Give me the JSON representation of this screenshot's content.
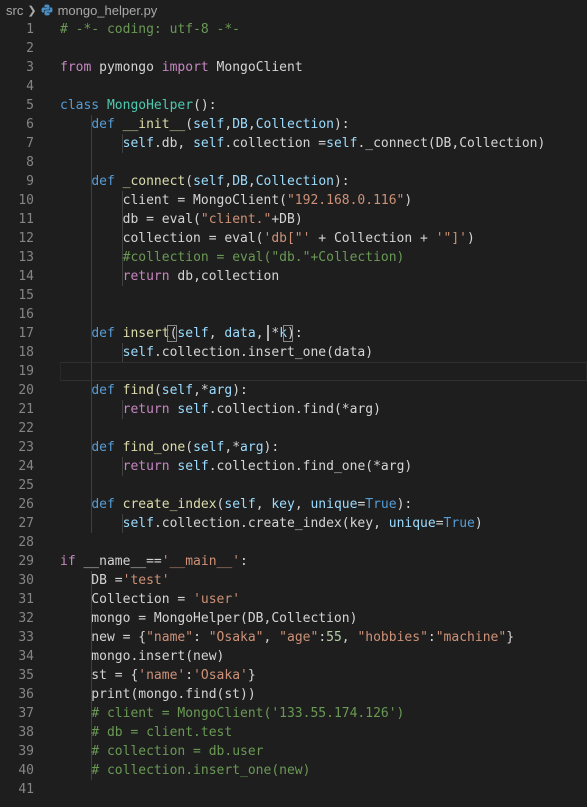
{
  "breadcrumb": {
    "folder": "src",
    "file": "mongo_helper.py",
    "file_icon": "python-icon"
  },
  "colors": {
    "background": "#1e1e1e",
    "keyword": "#569cd6",
    "control": "#c586c0",
    "function": "#dcdcaa",
    "class": "#4ec9b0",
    "string": "#ce9178",
    "number": "#b5cea8",
    "comment": "#6a9955",
    "variable": "#9cdcfe",
    "plain": "#d4d4d4",
    "line_number": "#858585"
  },
  "editor": {
    "active_line": 19,
    "lines": [
      {
        "n": "1",
        "t": [
          [
            "com",
            "# -*- coding: utf-8 -*-"
          ]
        ]
      },
      {
        "n": "2",
        "t": []
      },
      {
        "n": "3",
        "t": [
          [
            "ctl",
            "from"
          ],
          [
            "pl",
            " pymongo "
          ],
          [
            "ctl",
            "import"
          ],
          [
            "pl",
            " MongoClient"
          ]
        ]
      },
      {
        "n": "4",
        "t": []
      },
      {
        "n": "5",
        "t": [
          [
            "kw",
            "class"
          ],
          [
            "pl",
            " "
          ],
          [
            "cls",
            "MongoHelper"
          ],
          [
            "pl",
            "():"
          ]
        ]
      },
      {
        "n": "6",
        "t": [
          [
            "pl",
            "    "
          ],
          [
            "kw",
            "def"
          ],
          [
            "pl",
            " "
          ],
          [
            "fn",
            "__init__"
          ],
          [
            "pl",
            "("
          ],
          [
            "var",
            "self"
          ],
          [
            "pl",
            ","
          ],
          [
            "var",
            "DB"
          ],
          [
            "pl",
            ","
          ],
          [
            "var",
            "Collection"
          ],
          [
            "pl",
            "):"
          ]
        ]
      },
      {
        "n": "7",
        "t": [
          [
            "pl",
            "        "
          ],
          [
            "var",
            "self"
          ],
          [
            "pl",
            ".db, "
          ],
          [
            "var",
            "self"
          ],
          [
            "pl",
            ".collection ="
          ],
          [
            "var",
            "self"
          ],
          [
            "pl",
            "._connect(DB,Collection)"
          ]
        ]
      },
      {
        "n": "8",
        "t": []
      },
      {
        "n": "9",
        "t": [
          [
            "pl",
            "    "
          ],
          [
            "kw",
            "def"
          ],
          [
            "pl",
            " "
          ],
          [
            "fn",
            "_connect"
          ],
          [
            "pl",
            "("
          ],
          [
            "var",
            "self"
          ],
          [
            "pl",
            ","
          ],
          [
            "var",
            "DB"
          ],
          [
            "pl",
            ","
          ],
          [
            "var",
            "Collection"
          ],
          [
            "pl",
            "):"
          ]
        ]
      },
      {
        "n": "10",
        "t": [
          [
            "pl",
            "        client = MongoClient("
          ],
          [
            "str",
            "\"192.168.0.116\""
          ],
          [
            "pl",
            ")"
          ]
        ]
      },
      {
        "n": "11",
        "t": [
          [
            "pl",
            "        db = eval("
          ],
          [
            "str",
            "\"client.\""
          ],
          [
            "pl",
            "+DB)"
          ]
        ]
      },
      {
        "n": "12",
        "t": [
          [
            "pl",
            "        collection = eval("
          ],
          [
            "str",
            "'db[\"'"
          ],
          [
            "pl",
            " + Collection + "
          ],
          [
            "str",
            "'\"]'"
          ],
          [
            "pl",
            ")"
          ]
        ]
      },
      {
        "n": "13",
        "t": [
          [
            "pl",
            "        "
          ],
          [
            "com",
            "#collection = eval(\"db.\"+Collection)"
          ]
        ]
      },
      {
        "n": "14",
        "t": [
          [
            "pl",
            "        "
          ],
          [
            "ctl",
            "return"
          ],
          [
            "pl",
            " db,collection"
          ]
        ]
      },
      {
        "n": "15",
        "t": []
      },
      {
        "n": "16",
        "t": []
      },
      {
        "n": "17",
        "t": [
          [
            "pl",
            "    "
          ],
          [
            "kw",
            "def"
          ],
          [
            "pl",
            " "
          ],
          [
            "fn",
            "insert"
          ],
          [
            "pl",
            "("
          ],
          [
            "var",
            "self"
          ],
          [
            "pl",
            ", "
          ],
          [
            "var",
            "data"
          ],
          [
            "pl",
            ", *"
          ],
          [
            "var",
            "k"
          ],
          [
            "pl",
            "):"
          ]
        ]
      },
      {
        "n": "18",
        "t": [
          [
            "pl",
            "        "
          ],
          [
            "var",
            "self"
          ],
          [
            "pl",
            ".collection.insert_one(data)"
          ]
        ]
      },
      {
        "n": "19",
        "t": []
      },
      {
        "n": "20",
        "t": [
          [
            "pl",
            "    "
          ],
          [
            "kw",
            "def"
          ],
          [
            "pl",
            " "
          ],
          [
            "fn",
            "find"
          ],
          [
            "pl",
            "("
          ],
          [
            "var",
            "self"
          ],
          [
            "pl",
            ",*"
          ],
          [
            "var",
            "arg"
          ],
          [
            "pl",
            "):"
          ]
        ]
      },
      {
        "n": "21",
        "t": [
          [
            "pl",
            "        "
          ],
          [
            "ctl",
            "return"
          ],
          [
            "pl",
            " "
          ],
          [
            "var",
            "self"
          ],
          [
            "pl",
            ".collection.find(*arg)"
          ]
        ]
      },
      {
        "n": "22",
        "t": []
      },
      {
        "n": "23",
        "t": [
          [
            "pl",
            "    "
          ],
          [
            "kw",
            "def"
          ],
          [
            "pl",
            " "
          ],
          [
            "fn",
            "find_one"
          ],
          [
            "pl",
            "("
          ],
          [
            "var",
            "self"
          ],
          [
            "pl",
            ",*"
          ],
          [
            "var",
            "arg"
          ],
          [
            "pl",
            "):"
          ]
        ]
      },
      {
        "n": "24",
        "t": [
          [
            "pl",
            "        "
          ],
          [
            "ctl",
            "return"
          ],
          [
            "pl",
            " "
          ],
          [
            "var",
            "self"
          ],
          [
            "pl",
            ".collection.find_one(*arg)"
          ]
        ]
      },
      {
        "n": "25",
        "t": []
      },
      {
        "n": "26",
        "t": [
          [
            "pl",
            "    "
          ],
          [
            "kw",
            "def"
          ],
          [
            "pl",
            " "
          ],
          [
            "fn",
            "create_index"
          ],
          [
            "pl",
            "("
          ],
          [
            "var",
            "self"
          ],
          [
            "pl",
            ", "
          ],
          [
            "var",
            "key"
          ],
          [
            "pl",
            ", "
          ],
          [
            "var",
            "unique"
          ],
          [
            "pl",
            "="
          ],
          [
            "kw",
            "True"
          ],
          [
            "pl",
            "):"
          ]
        ]
      },
      {
        "n": "27",
        "t": [
          [
            "pl",
            "        "
          ],
          [
            "var",
            "self"
          ],
          [
            "pl",
            ".collection.create_index(key, "
          ],
          [
            "var",
            "unique"
          ],
          [
            "pl",
            "="
          ],
          [
            "kw",
            "True"
          ],
          [
            "pl",
            ")"
          ]
        ]
      },
      {
        "n": "28",
        "t": []
      },
      {
        "n": "29",
        "t": [
          [
            "ctl",
            "if"
          ],
          [
            "pl",
            " __name__=="
          ],
          [
            "str",
            "'__main__'"
          ],
          [
            "pl",
            ":"
          ]
        ]
      },
      {
        "n": "30",
        "t": [
          [
            "pl",
            "    DB ="
          ],
          [
            "str",
            "'test'"
          ]
        ]
      },
      {
        "n": "31",
        "t": [
          [
            "pl",
            "    Collection = "
          ],
          [
            "str",
            "'user'"
          ]
        ]
      },
      {
        "n": "32",
        "t": [
          [
            "pl",
            "    mongo = MongoHelper(DB,Collection)"
          ]
        ]
      },
      {
        "n": "33",
        "t": [
          [
            "pl",
            "    new = {"
          ],
          [
            "str",
            "\"name\""
          ],
          [
            "pl",
            ": "
          ],
          [
            "str",
            "\"Osaka\""
          ],
          [
            "pl",
            ", "
          ],
          [
            "str",
            "\"age\""
          ],
          [
            "pl",
            ":"
          ],
          [
            "num",
            "55"
          ],
          [
            "pl",
            ", "
          ],
          [
            "str",
            "\"hobbies\""
          ],
          [
            "pl",
            ":"
          ],
          [
            "str",
            "\"machine\""
          ],
          [
            "pl",
            "}"
          ]
        ]
      },
      {
        "n": "34",
        "t": [
          [
            "pl",
            "    mongo.insert(new)"
          ]
        ]
      },
      {
        "n": "35",
        "t": [
          [
            "pl",
            "    st = {"
          ],
          [
            "str",
            "'name'"
          ],
          [
            "pl",
            ":"
          ],
          [
            "str",
            "'Osaka'"
          ],
          [
            "pl",
            "}"
          ]
        ]
      },
      {
        "n": "36",
        "t": [
          [
            "pl",
            "    print(mongo.find(st))"
          ]
        ]
      },
      {
        "n": "37",
        "t": [
          [
            "pl",
            "    "
          ],
          [
            "com",
            "# client = MongoClient('133.55.174.126')"
          ]
        ]
      },
      {
        "n": "38",
        "t": [
          [
            "pl",
            "    "
          ],
          [
            "com",
            "# db = client.test"
          ]
        ]
      },
      {
        "n": "39",
        "t": [
          [
            "pl",
            "    "
          ],
          [
            "com",
            "# collection = db.user"
          ]
        ]
      },
      {
        "n": "40",
        "t": [
          [
            "pl",
            "    "
          ],
          [
            "com",
            "# collection.insert_one(new)"
          ]
        ]
      },
      {
        "n": "41",
        "t": []
      }
    ]
  }
}
